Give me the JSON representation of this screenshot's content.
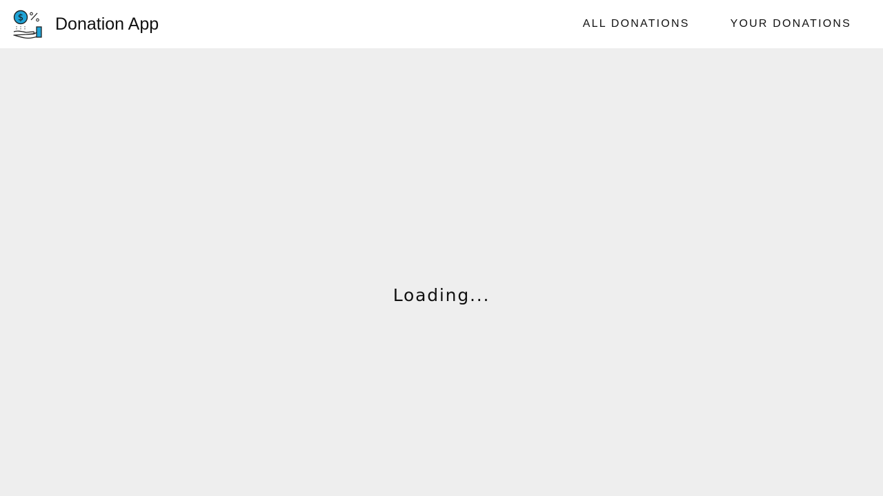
{
  "header": {
    "logo_icon": "hand-holding-coin-icon",
    "title": "Donation App",
    "nav": [
      {
        "label": "ALL DONATIONS"
      },
      {
        "label": "YOUR DONATIONS"
      }
    ]
  },
  "main": {
    "loading_text": "Loading..."
  },
  "colors": {
    "header_background": "#ffffff",
    "page_background": "#eeeeee",
    "accent_coin": "#1fa3d6",
    "text": "#111111"
  }
}
